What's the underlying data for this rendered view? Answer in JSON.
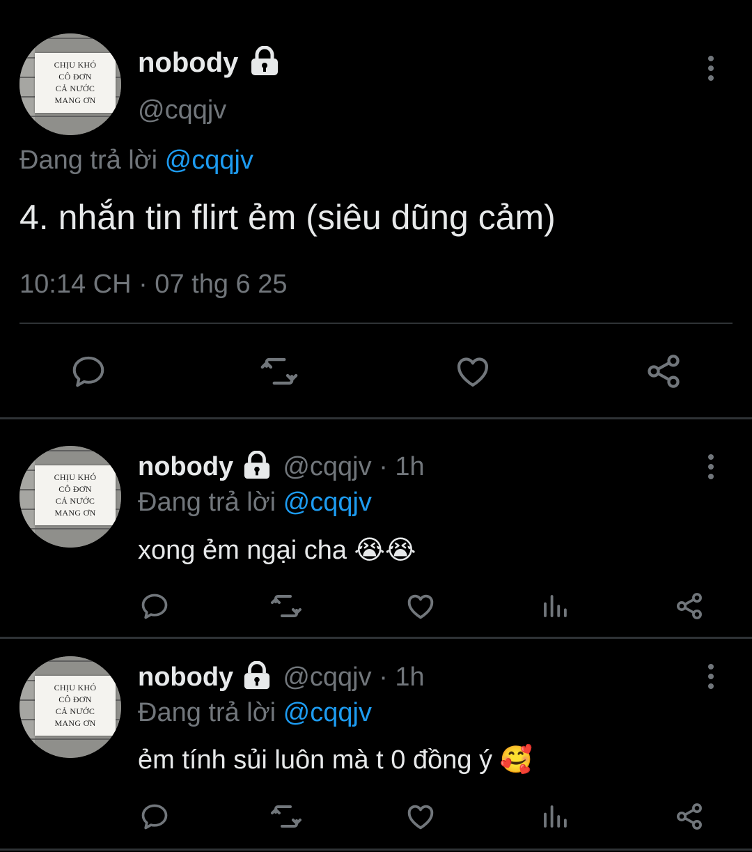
{
  "main_tweet": {
    "author_name": "nobody",
    "handle": "@cqqjv",
    "replying_prefix": "Đang trả lời",
    "replying_to": "@cqqjv",
    "text": "4. nhắn tin flirt ẻm (siêu dũng cảm)",
    "timestamp": "10:14 CH · 07 thg 6 25"
  },
  "avatar_sign": [
    "CHỊU KHÓ",
    "CÔ ĐƠN",
    "CẢ NƯỚC",
    "MANG ƠN"
  ],
  "replies": [
    {
      "author_name": "nobody",
      "handle": "@cqqjv",
      "time": "· 1h",
      "replying_prefix": "Đang trả lời",
      "replying_to": "@cqqjv",
      "text": "xong ẻm ngại cha",
      "emoji": "😭😭"
    },
    {
      "author_name": "nobody",
      "handle": "@cqqjv",
      "time": "· 1h",
      "replying_prefix": "Đang trả lời",
      "replying_to": "@cqqjv",
      "text": "ẻm tính sủi luôn mà t 0 đồng ý",
      "emoji": "🥰"
    }
  ],
  "icons": [
    "reply-icon",
    "retweet-icon",
    "like-icon",
    "views-icon",
    "share-icon",
    "more-icon",
    "lock-icon"
  ],
  "colors": {
    "background": "#000000",
    "text": "#e7e9ea",
    "muted": "#71767b",
    "link": "#1d9bf0",
    "divider": "#2f3336"
  }
}
